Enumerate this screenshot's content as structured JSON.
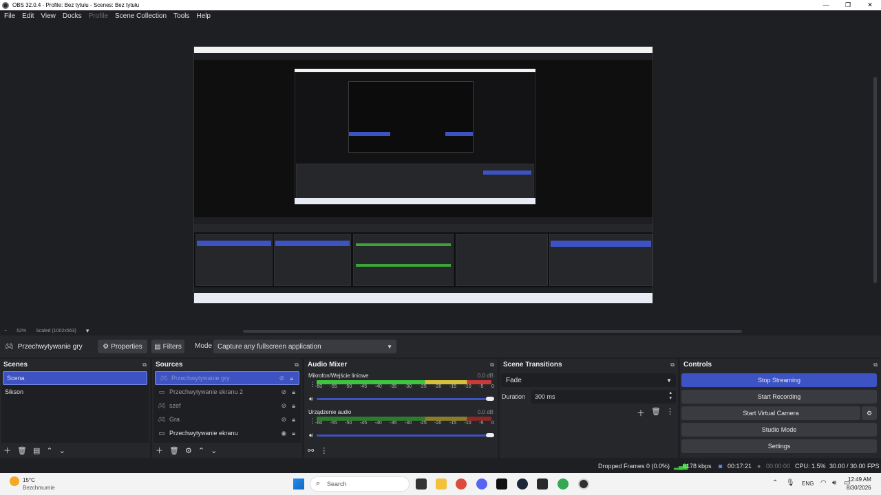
{
  "window": {
    "title": "OBS 32.0.4 - Profile: Bez tytułu - Scenes: Bez tytułu",
    "minimize": "—",
    "maximize": "❐",
    "close": "✕"
  },
  "menu": {
    "file": "File",
    "edit": "Edit",
    "view": "View",
    "docks": "Docks",
    "profile": "Profile",
    "scene_collection": "Scene Collection",
    "tools": "Tools",
    "help": "Help"
  },
  "zoom": {
    "minus": "−",
    "level": "52%",
    "scaled": "Scaled (1002x563)",
    "dropdown": "▾"
  },
  "source_toolbar": {
    "source_name": "Przechwytywanie gry",
    "properties_label": "Properties",
    "filters_label": "Filters",
    "mode_label": "Mode",
    "mode_value": "Capture any fullscreen application"
  },
  "scenes": {
    "title": "Scenes",
    "items": [
      "Scena",
      "Sikson"
    ]
  },
  "sources": {
    "title": "Sources",
    "items": [
      {
        "label": "Przechwytywanie gry",
        "icon": "gamepad-icon"
      },
      {
        "label": "Przechwytywanie ekranu 2",
        "icon": "monitor-icon"
      },
      {
        "label": "szef",
        "icon": "gamepad-icon"
      },
      {
        "label": "Gra",
        "icon": "gamepad-icon"
      },
      {
        "label": "Przechwytywanie ekranu",
        "icon": "monitor-icon"
      }
    ]
  },
  "audio_mixer": {
    "title": "Audio Mixer",
    "channels": [
      {
        "name": "Mikrofon/Wejście liniowe",
        "db": "0.0 dB",
        "volume": 1.0
      },
      {
        "name": "Urządzenie audio",
        "db": "0.0 dB",
        "volume": 1.0
      }
    ],
    "ticks": [
      "-60",
      "-55",
      "-50",
      "-45",
      "-40",
      "-35",
      "-30",
      "-25",
      "-20",
      "-15",
      "-10",
      "-5",
      "0"
    ]
  },
  "transitions": {
    "title": "Scene Transitions",
    "selected": "Fade",
    "duration_label": "Duration",
    "duration_value": "300 ms"
  },
  "controls": {
    "title": "Controls",
    "stop_streaming": "Stop Streaming",
    "start_recording": "Start Recording",
    "start_virtual_camera": "Start Virtual Camera",
    "studio_mode": "Studio Mode",
    "settings": "Settings"
  },
  "status": {
    "dropped_frames": "Dropped Frames 0 (0.0%)",
    "bitrate": "6178 kbps",
    "stream_time": "00:17:21",
    "rec_time": "00:00:00",
    "cpu": "CPU: 1.5%",
    "fps": "30.00 / 30.00 FPS"
  },
  "taskbar": {
    "temperature": "15°C",
    "weather": "Bezchmurnie",
    "search_placeholder": "Search",
    "language": "ENG",
    "time": "12:49 AM",
    "date": "8/30/2026"
  },
  "colors": {
    "accent": "#3d53c4",
    "dock_bg": "#26272b",
    "panel_bg": "#1e1f22"
  }
}
